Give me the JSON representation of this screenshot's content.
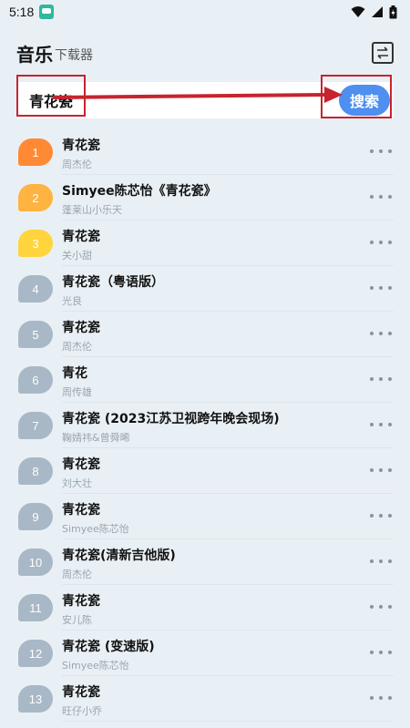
{
  "status_bar": {
    "time": "5:18"
  },
  "header": {
    "title": "音乐",
    "subtitle": "下载器"
  },
  "search": {
    "value": "青花瓷",
    "button_label": "搜索"
  },
  "colors": {
    "rank1": "#ff8a33",
    "rank2": "#ffb340",
    "rank3": "#ffd43d",
    "rank_default": "#a9b8c6",
    "accent": "#4e8ff0",
    "annotation": "#c6242e"
  },
  "songs": [
    {
      "rank": "1",
      "title": "青花瓷",
      "artist": "周杰伦"
    },
    {
      "rank": "2",
      "title": "Simyee陈芯怡《青花瓷》",
      "artist": "蓬莱山小乐天"
    },
    {
      "rank": "3",
      "title": "青花瓷",
      "artist": "关小甜"
    },
    {
      "rank": "4",
      "title": "青花瓷（粤语版）",
      "artist": "光良"
    },
    {
      "rank": "5",
      "title": "青花瓷",
      "artist": "周杰伦"
    },
    {
      "rank": "6",
      "title": "青花",
      "artist": "周传雄"
    },
    {
      "rank": "7",
      "title": "青花瓷 (2023江苏卫视跨年晚会现场)",
      "artist": "鞠婧祎&曾舜晞"
    },
    {
      "rank": "8",
      "title": "青花瓷",
      "artist": "刘大壮"
    },
    {
      "rank": "9",
      "title": "青花瓷",
      "artist": "Simyee陈芯怡"
    },
    {
      "rank": "10",
      "title": "青花瓷(清新吉他版)",
      "artist": "周杰伦"
    },
    {
      "rank": "11",
      "title": "青花瓷",
      "artist": "安儿陈"
    },
    {
      "rank": "12",
      "title": "青花瓷 (变速版)",
      "artist": "Simyee陈芯怡"
    },
    {
      "rank": "13",
      "title": "青花瓷",
      "artist": "旺仔小乔"
    }
  ]
}
